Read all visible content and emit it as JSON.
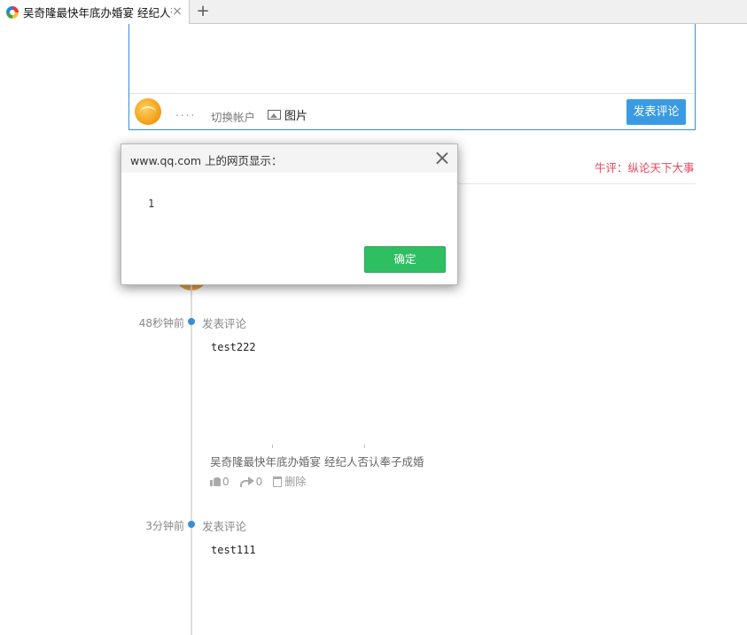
{
  "browser": {
    "tab_title": "吴奇隆最快年底办婚宴 经纪人否",
    "tab_close": "×",
    "new_tab": "+"
  },
  "composer": {
    "nickname": "....",
    "switch_account": "切换帐户",
    "image_label": "图片",
    "submit": "发表评论"
  },
  "section": {
    "niuping": "牛评：纵论天下大事"
  },
  "timeline": {
    "entries": [
      {
        "time": "48秒钟前",
        "action": "发表评论",
        "text": "test222",
        "article_title": "吴奇隆最快年底办婚宴 经纪人否认奉子成婚",
        "likes": "0",
        "shares": "0",
        "delete_label": "删除"
      },
      {
        "time": "3分钟前",
        "action": "发表评论",
        "text": "test111"
      }
    ]
  },
  "dialog": {
    "title": "www.qq.com 上的网页显示：",
    "message": "1",
    "ok": "确定"
  },
  "colors": {
    "accent_blue": "#3a9be3",
    "ok_green": "#2fbf63",
    "niuping_red": "#e8465a"
  }
}
